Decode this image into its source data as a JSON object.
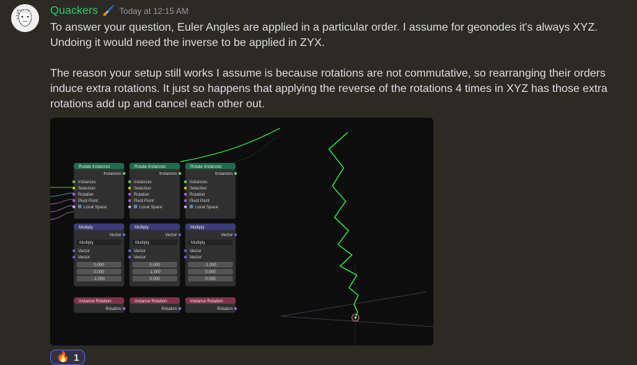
{
  "message": {
    "author": "Quackers",
    "badge": "🖌️",
    "timestamp": "Today at 12:15 AM",
    "paragraph1": "To answer your question, Euler Angles are applied in a particular order. I assume for geonodes it's always XYZ. Undoing it would need the inverse to be applied in ZYX.",
    "paragraph2": "The reason your setup still works I assume is because rotations are not commutative, so rearranging their orders induce extra rotations. It just so happens that applying the reverse of the rotations 4 times in XYZ has those extra rotations add up and cancel each other out."
  },
  "reaction": {
    "emoji": "🔥",
    "count": "1"
  },
  "nodes": {
    "rotate": {
      "title": "Rotate Instances",
      "rows": [
        "Instances",
        "Instances",
        "Selection",
        "Rotation",
        "Pivot Point",
        "Local Space"
      ]
    },
    "multiply": {
      "title": "Multiply",
      "out": "Vector",
      "mode": "Multiply",
      "rows": [
        "Vector",
        "Vector:"
      ]
    },
    "vec1": [
      "0.000",
      "0.000",
      "-1.000"
    ],
    "vec2": [
      "0.000",
      "-1.000",
      "0.000"
    ],
    "vec3": [
      "-1.000",
      "0.000",
      "0.000"
    ],
    "instRot": {
      "title": "Instance Rotation",
      "out": "Rotation"
    }
  }
}
